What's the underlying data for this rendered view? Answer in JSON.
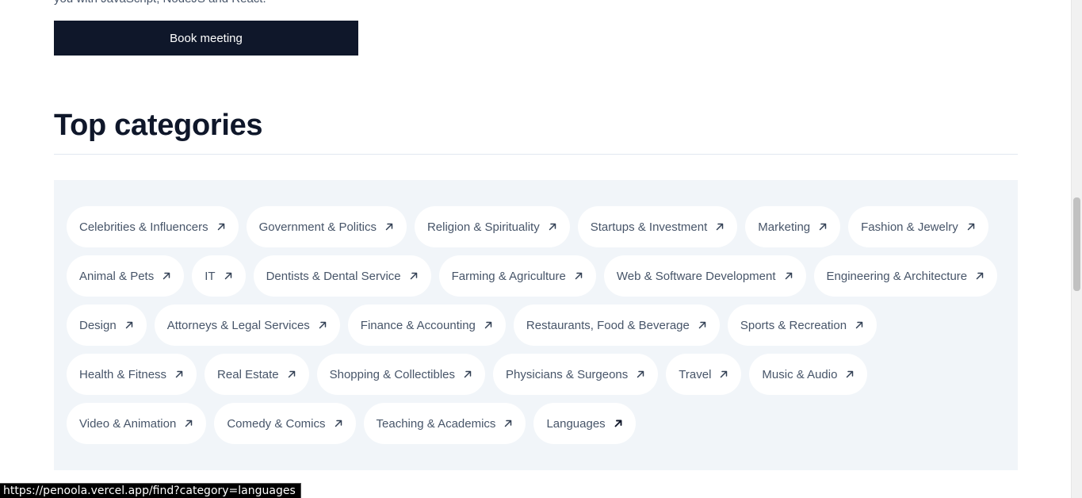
{
  "intro": {
    "tail_text": "you with JavaScript, NodeJS and React."
  },
  "booking": {
    "button_label": "Book meeting"
  },
  "categories": {
    "title": "Top categories",
    "items": [
      {
        "label": "Celebrities & Influencers"
      },
      {
        "label": "Government & Politics"
      },
      {
        "label": "Religion & Spirituality"
      },
      {
        "label": "Startups & Investment"
      },
      {
        "label": "Marketing"
      },
      {
        "label": "Fashion & Jewelry"
      },
      {
        "label": "Animal & Pets"
      },
      {
        "label": "IT"
      },
      {
        "label": "Dentists & Dental Service"
      },
      {
        "label": "Farming & Agriculture"
      },
      {
        "label": "Web & Software Development"
      },
      {
        "label": "Engineering & Architecture"
      },
      {
        "label": "Design"
      },
      {
        "label": "Attorneys & Legal Services"
      },
      {
        "label": "Finance & Accounting"
      },
      {
        "label": "Restaurants, Food & Beverage"
      },
      {
        "label": "Sports & Recreation"
      },
      {
        "label": "Health & Fitness"
      },
      {
        "label": "Real Estate"
      },
      {
        "label": "Shopping & Collectibles"
      },
      {
        "label": "Physicians & Surgeons"
      },
      {
        "label": "Travel"
      },
      {
        "label": "Music & Audio"
      },
      {
        "label": "Video & Animation"
      },
      {
        "label": "Comedy & Comics"
      },
      {
        "label": "Teaching & Academics"
      },
      {
        "label": "Languages"
      }
    ],
    "arrow_icon": "arrow-up-right-icon"
  },
  "status_bar": {
    "url": "https://penoola.vercel.app/find?category=languages"
  },
  "colors": {
    "primary": "#0f172a",
    "panel_bg": "#f1f5f9",
    "chip_text": "#475569"
  }
}
